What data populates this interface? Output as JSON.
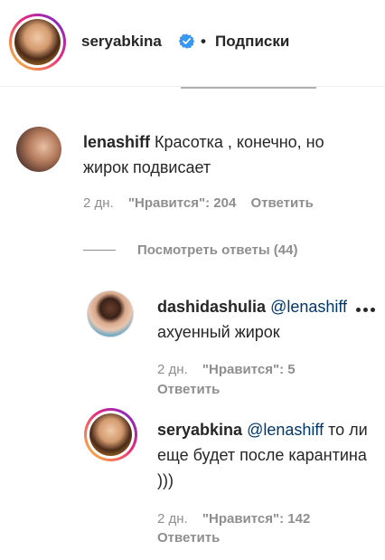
{
  "header": {
    "username": "seryabkina",
    "separator": "•",
    "follow_label": "Подписки",
    "verified_icon": "verified-badge-icon",
    "accent_color": "#3897f0"
  },
  "comment": {
    "username": "lenashiff",
    "text": "Красотка , конечно, но жирок подвисает",
    "time": "2 дн.",
    "likes": "\"Нравится\": 204",
    "reply": "Ответить"
  },
  "view_replies": "Посмотреть ответы (44)",
  "replies": [
    {
      "username": "dashidashulia",
      "mention": "@lenashiff",
      "text": "ахуенный жирок",
      "time": "2 дн.",
      "likes": "\"Нравится\": 5",
      "reply": "Ответить"
    },
    {
      "username": "seryabkina",
      "mention": "@lenashiff",
      "text": "то ли еще будет после карантина )))",
      "time": "2 дн.",
      "likes": "\"Нравится\": 142",
      "reply": "Ответить"
    }
  ]
}
